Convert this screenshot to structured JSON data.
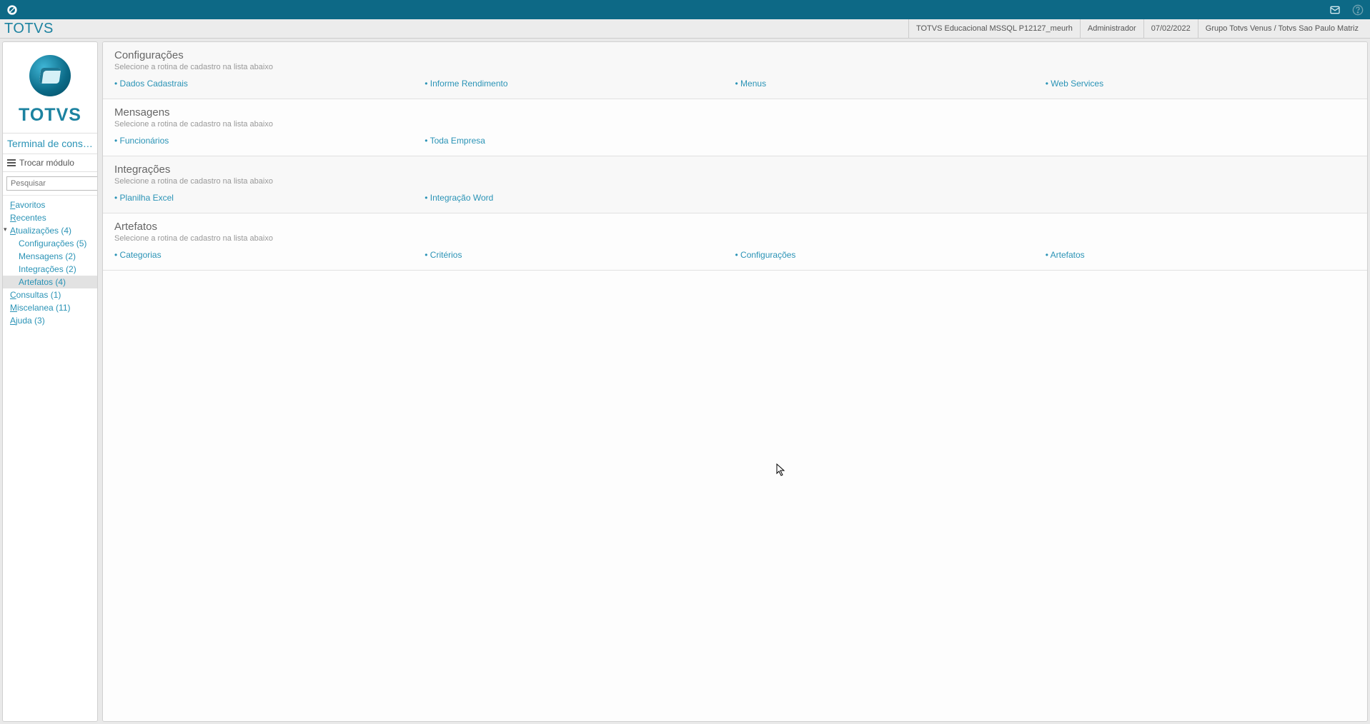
{
  "brand": "TOTVS",
  "header": {
    "env": "TOTVS Educacional MSSQL P12127_meurh",
    "user": "Administrador",
    "date": "07/02/2022",
    "group": "Grupo Totvs Venus / Totvs Sao Paulo Matriz"
  },
  "sidebar": {
    "module": "Terminal de consul...",
    "switch_label": "Trocar módulo",
    "search_placeholder": "Pesquisar",
    "nav": {
      "favoritos": "Favoritos",
      "recentes": "Recentes",
      "atualizacoes": "Atualizações (4)",
      "atualizacoes_children": {
        "configuracoes": "Configurações (5)",
        "mensagens": "Mensagens (2)",
        "integracoes": "Integrações (2)",
        "artefatos": "Artefatos (4)"
      },
      "consultas": "Consultas (1)",
      "miscelanea": "Miscelanea (11)",
      "ajuda": "Ajuda (3)"
    }
  },
  "sections": [
    {
      "title": "Configurações",
      "subtitle": "Selecione a rotina de cadastro na lista abaixo",
      "links": [
        "Dados Cadastrais",
        "Informe Rendimento",
        "Menus",
        "Web Services"
      ]
    },
    {
      "title": "Mensagens",
      "subtitle": "Selecione a rotina de cadastro na lista abaixo",
      "links": [
        "Funcionários",
        "Toda Empresa"
      ]
    },
    {
      "title": "Integrações",
      "subtitle": "Selecione a rotina de cadastro na lista abaixo",
      "links": [
        "Planilha Excel",
        "Integração Word"
      ]
    },
    {
      "title": "Artefatos",
      "subtitle": "Selecione a rotina de cadastro na lista abaixo",
      "links": [
        "Categorias",
        "Critérios",
        "Configurações",
        "Artefatos"
      ]
    }
  ]
}
